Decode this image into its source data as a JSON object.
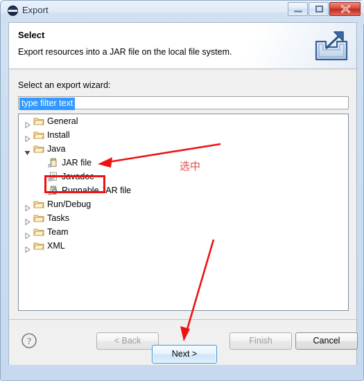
{
  "window": {
    "title": "Export",
    "icon": "export-circle-icon",
    "ghost_text": "  ",
    "controls": {
      "minimize": "minimize-icon",
      "maximize": "maximize-icon",
      "close": "close-icon"
    }
  },
  "header": {
    "title": "Select",
    "description": "Export resources into a JAR file on the local file system.",
    "icon": "export-arrow-icon"
  },
  "body": {
    "wizard_label": "Select an export wizard:",
    "filter": {
      "value": "type filter text",
      "placeholder": "type filter text",
      "selected": true
    },
    "tree": [
      {
        "label": "General",
        "depth": 1,
        "state": "collapsed",
        "icon": "folder-icon"
      },
      {
        "label": "Install",
        "depth": 1,
        "state": "collapsed",
        "icon": "folder-icon"
      },
      {
        "label": "Java",
        "depth": 1,
        "state": "expanded",
        "icon": "folder-icon"
      },
      {
        "label": "JAR file",
        "depth": 2,
        "state": "leaf",
        "icon": "jar-file-icon"
      },
      {
        "label": "Javadoc",
        "depth": 2,
        "state": "leaf",
        "icon": "javadoc-icon"
      },
      {
        "label": "Runnable JAR file",
        "depth": 2,
        "state": "leaf",
        "icon": "runnable-jar-icon"
      },
      {
        "label": "Run/Debug",
        "depth": 1,
        "state": "collapsed",
        "icon": "folder-icon"
      },
      {
        "label": "Tasks",
        "depth": 1,
        "state": "collapsed",
        "icon": "folder-icon"
      },
      {
        "label": "Team",
        "depth": 1,
        "state": "collapsed",
        "icon": "folder-icon"
      },
      {
        "label": "XML",
        "depth": 1,
        "state": "collapsed",
        "icon": "folder-icon"
      }
    ]
  },
  "annotations": {
    "note_text": "选中",
    "color": "#ee1111",
    "highlight_target": "JAR file",
    "arrow_to_jar": "arrow pointing left to JAR file row",
    "arrow_to_next": "arrow pointing down-left to Next button"
  },
  "buttons": {
    "help": "?",
    "back": "< Back",
    "next": "Next >",
    "finish": "Finish",
    "cancel": "Cancel",
    "back_enabled": false,
    "next_enabled": true,
    "finish_enabled": false,
    "cancel_enabled": true
  }
}
